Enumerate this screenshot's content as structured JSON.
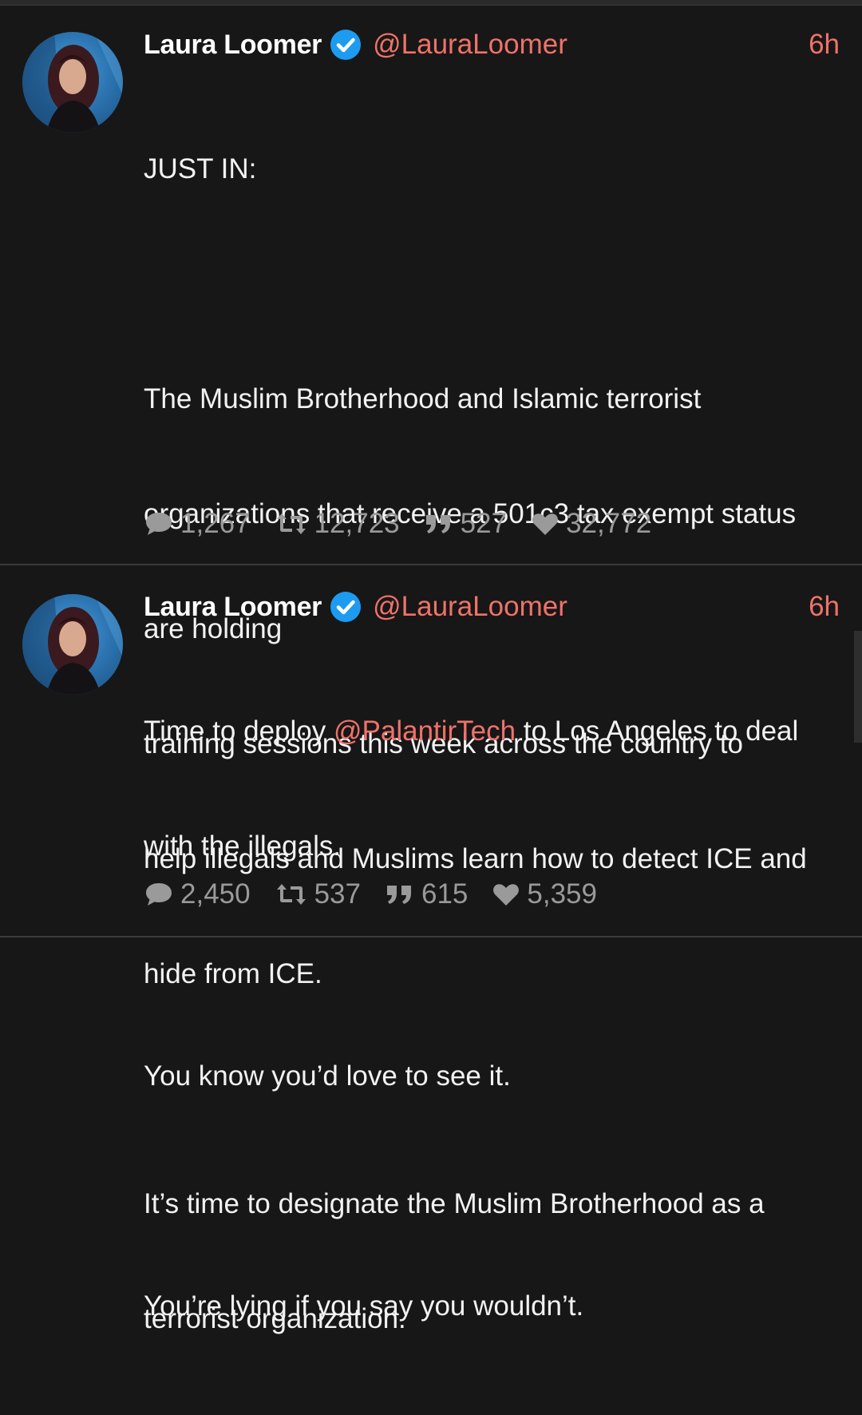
{
  "tweets": [
    {
      "author_name": "Laura Loomer",
      "handle": "@LauraLoomer",
      "time": "6h",
      "body_lines": [
        "JUST IN:",
        "",
        "The Muslim Brotherhood and Islamic terrorist",
        "organizations that receive a 501c3 tax exempt status",
        "are holding",
        "training sessions this week across the country to",
        "help illegals and Muslims learn how to detect ICE and",
        "hide from ICE.",
        "",
        "It’s time to designate the Muslim Brotherhood as a",
        "terrorist organization."
      ],
      "stats": {
        "replies": "1,267",
        "retweets": "12,723",
        "quotes": "527",
        "likes": "32,772"
      }
    },
    {
      "author_name": "Laura Loomer",
      "handle": "@LauraLoomer",
      "time": "6h",
      "body_pre": "Time to deploy ",
      "body_mention": "@PalantirTech",
      "body_post": " to Los Angeles to deal",
      "body_lines": [
        "with the illegals.",
        "",
        "You know you’d love to see it.",
        "",
        "You’re lying if you say you wouldn’t."
      ],
      "stats": {
        "replies": "2,450",
        "retweets": "537",
        "quotes": "615",
        "likes": "5,359"
      }
    }
  ],
  "colors": {
    "background": "#171717",
    "accent": "#f0726a",
    "verified": "#1d9bf0",
    "muted": "#9a9a9a"
  },
  "icons": [
    "verified-badge-icon",
    "reply-icon",
    "retweet-icon",
    "quote-icon",
    "like-icon"
  ]
}
